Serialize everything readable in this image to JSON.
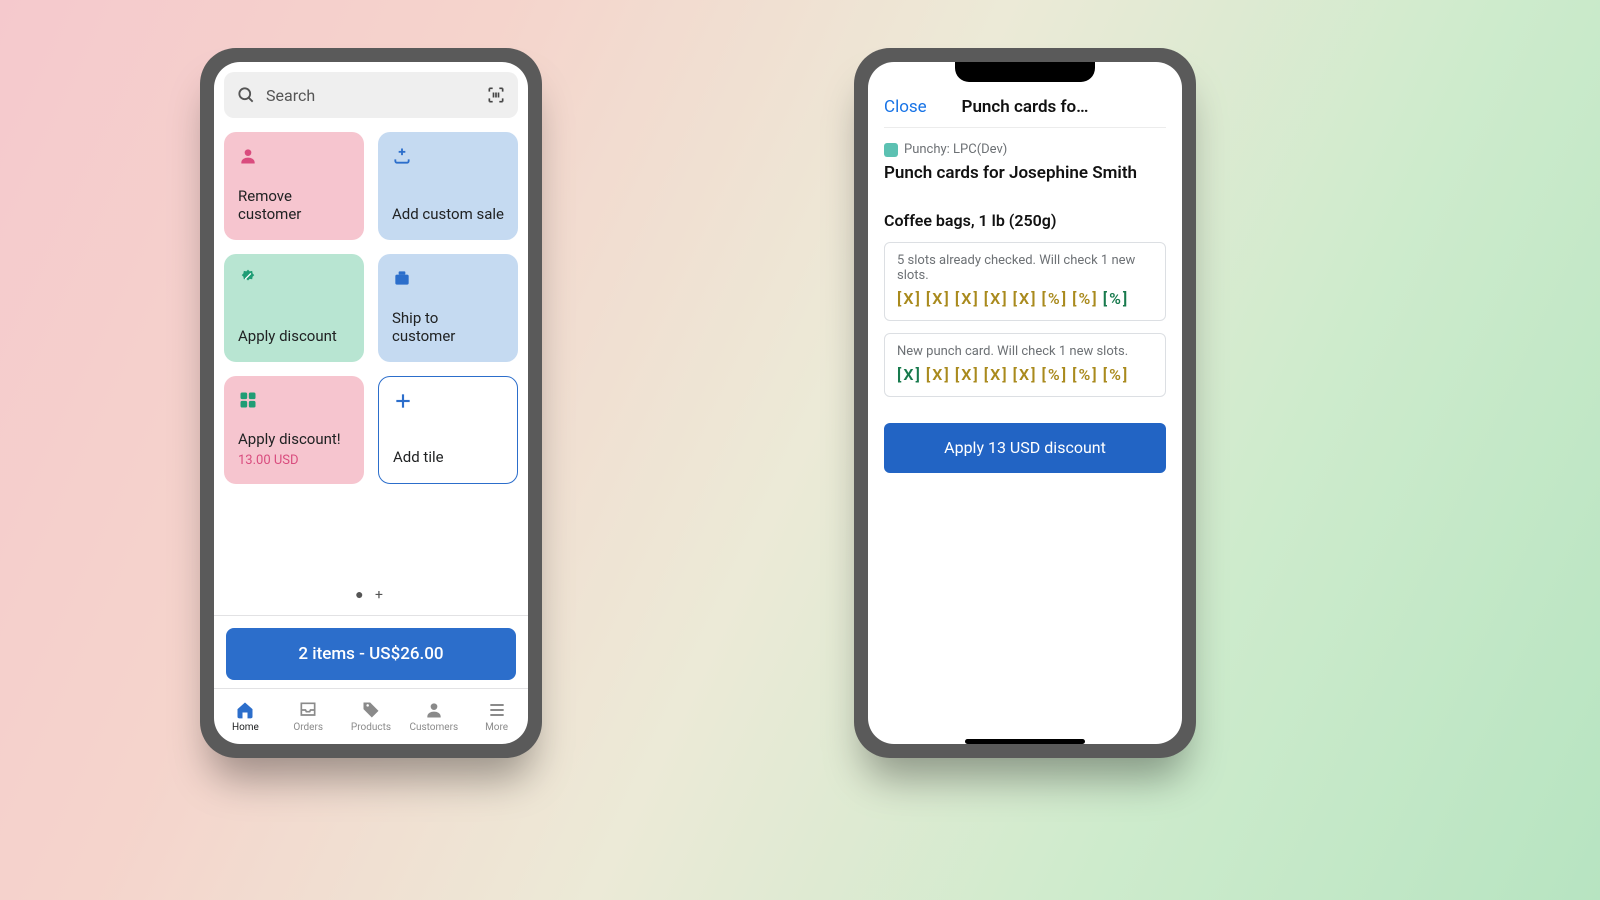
{
  "left": {
    "search_placeholder": "Search",
    "tiles": {
      "remove_customer": "Remove customer",
      "add_custom_sale": "Add custom sale",
      "apply_discount": "Apply discount",
      "ship_to_customer": "Ship to customer",
      "apply_discount_bang": "Apply discount!",
      "apply_discount_sub": "13.00 USD",
      "add_tile": "Add tile"
    },
    "cart_button": "2 items - US$26.00",
    "nav": {
      "home": "Home",
      "orders": "Orders",
      "products": "Products",
      "customers": "Customers",
      "more": "More"
    }
  },
  "right": {
    "close": "Close",
    "title": "Punch cards fo…",
    "app_name": "Punchy: LPC(Dev)",
    "heading": "Punch cards for Josephine Smith",
    "product": "Coffee bags, 1 lb (250g)",
    "card1_note": "5 slots already checked. Will check 1 new slots.",
    "card2_note": "New punch card. Will check 1 new slots.",
    "apply": "Apply 13 USD discount",
    "card1_slots": [
      {
        "t": "[X]",
        "c": "sx"
      },
      {
        "t": "[X]",
        "c": "sx"
      },
      {
        "t": "[X]",
        "c": "sx"
      },
      {
        "t": "[X]",
        "c": "sx"
      },
      {
        "t": "[X]",
        "c": "sx"
      },
      {
        "t": "[%]",
        "c": "sp"
      },
      {
        "t": "[%]",
        "c": "sp"
      },
      {
        "t": "[%]",
        "c": "snp"
      }
    ],
    "card2_slots": [
      {
        "t": "[X]",
        "c": "snx"
      },
      {
        "t": "[X]",
        "c": "sx"
      },
      {
        "t": "[X]",
        "c": "sx"
      },
      {
        "t": "[X]",
        "c": "sx"
      },
      {
        "t": "[X]",
        "c": "sx"
      },
      {
        "t": "[%]",
        "c": "sp"
      },
      {
        "t": "[%]",
        "c": "sp"
      },
      {
        "t": "[%]",
        "c": "sp"
      }
    ]
  }
}
